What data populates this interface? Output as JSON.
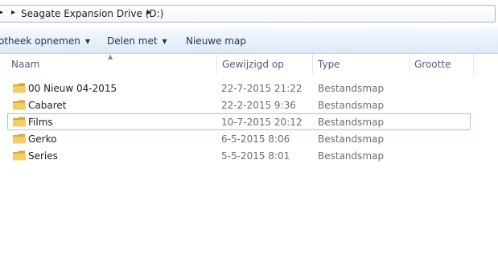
{
  "address": {
    "path": "Seagate Expansion Drive (D:)"
  },
  "command_bar": {
    "items": [
      {
        "label": "otheek opnemen",
        "dropdown": true
      },
      {
        "label": "Delen met",
        "dropdown": true
      },
      {
        "label": "Nieuwe map",
        "dropdown": false
      }
    ]
  },
  "columns": {
    "name": "Naam",
    "modified": "Gewijzigd op",
    "type": "Type",
    "size": "Grootte"
  },
  "rows": [
    {
      "name": "00 Nieuw 04-2015",
      "modified": "22-7-2015 21:22",
      "type": "Bestandsmap",
      "icon": "folder-icon"
    },
    {
      "name": "Cabaret",
      "modified": "22-2-2015 9:36",
      "type": "Bestandsmap",
      "icon": "folder-icon"
    },
    {
      "name": "Films",
      "modified": "10-7-2015 20:12",
      "type": "Bestandsmap",
      "icon": "folder-icon",
      "focused": true
    },
    {
      "name": "Gerko",
      "modified": "6-5-2015 8:06",
      "type": "Bestandsmap",
      "icon": "folder-icon"
    },
    {
      "name": "Series",
      "modified": "5-5-2015 8:01",
      "type": "Bestandsmap",
      "icon": "folder-icon"
    }
  ],
  "colors": {
    "toolbar": "#dde8f5",
    "focus_border": "#a3c4e8",
    "folder": "#e8c15a"
  }
}
